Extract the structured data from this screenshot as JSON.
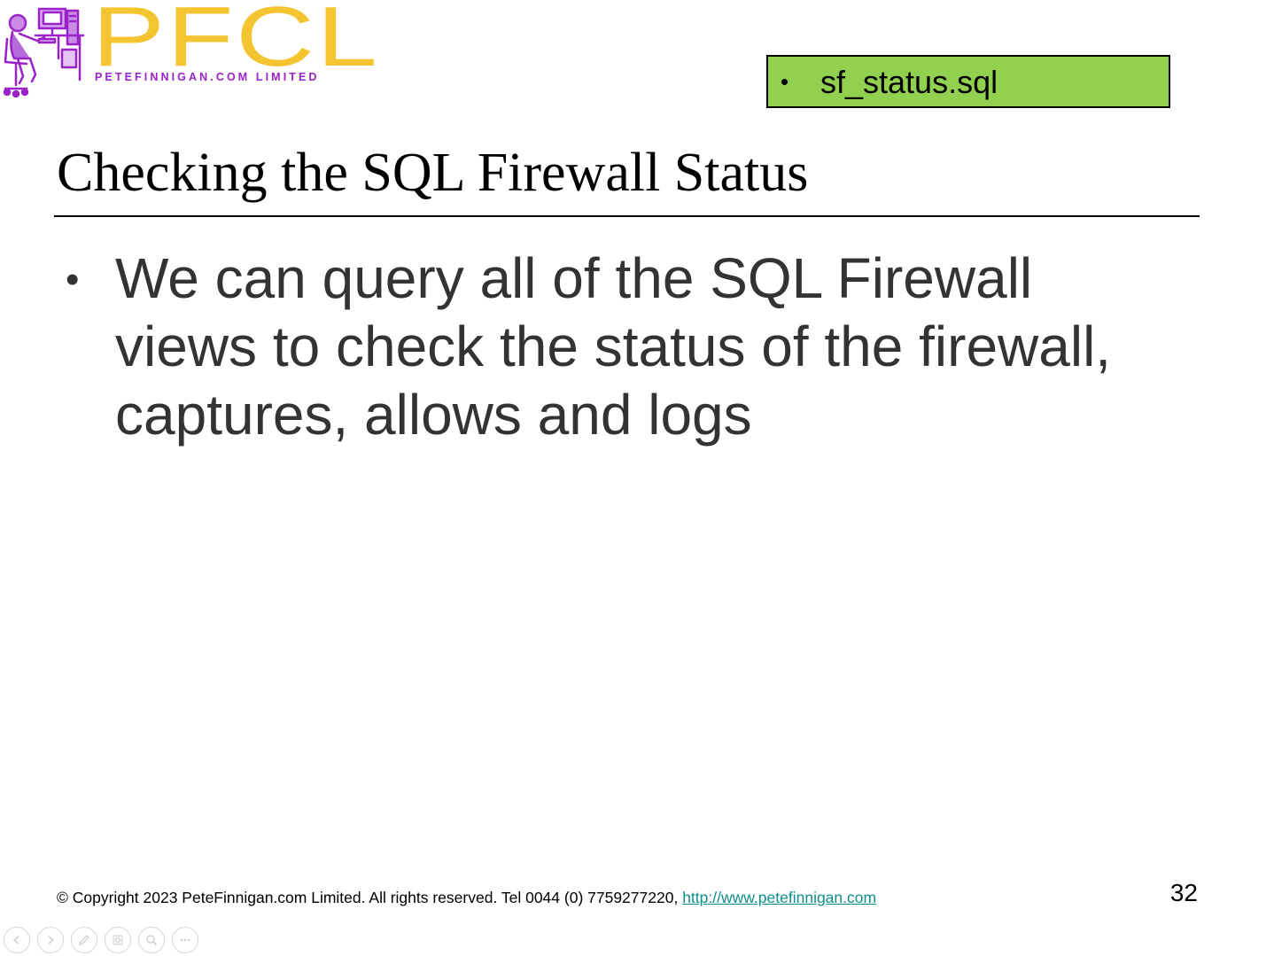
{
  "logo": {
    "letters": "PFCL",
    "subtitle": "PETEFINNIGAN.COM LIMITED",
    "figure_icon": "person-at-computer-icon",
    "colors": {
      "letters": "#f5c531",
      "figure": "#9a22c9"
    }
  },
  "file_box": {
    "bullet": "•",
    "text": "sf_status.sql",
    "background": "#92d050"
  },
  "slide": {
    "title": "Checking the SQL Firewall Status",
    "bullets": [
      {
        "marker": "•",
        "text": "We can query all of the SQL Firewall views to check the status of the firewall, captures, allows and logs"
      }
    ]
  },
  "footer": {
    "copyright": "© Copyright 2023 PeteFinnigan.com Limited. All rights reserved. Tel 0044 (0) 7759277220,",
    "link_text": "http://www.petefinnigan.com",
    "link_color": "#0f8f8f",
    "page_number": "32"
  },
  "controls": [
    {
      "icon": "previous-slide-icon"
    },
    {
      "icon": "next-slide-icon"
    },
    {
      "icon": "pen-icon"
    },
    {
      "icon": "slides-grid-icon"
    },
    {
      "icon": "zoom-icon"
    },
    {
      "icon": "more-options-icon"
    }
  ]
}
